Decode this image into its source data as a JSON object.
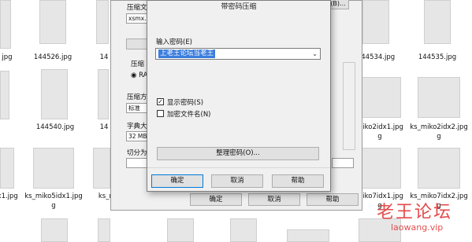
{
  "files": [
    {
      "label": "jpg"
    },
    {
      "label": "144526.jpg"
    },
    {
      "label": "14"
    },
    {
      "label": "144534.jpg"
    },
    {
      "label": "144535.jpg"
    },
    {
      "label": ""
    },
    {
      "label": "144540.jpg"
    },
    {
      "label": "14"
    },
    {
      "label": "miko2idx1.jpg"
    },
    {
      "label": "ks_miko2idx2.jpg"
    },
    {
      "label": "dx1.jpg"
    },
    {
      "label": "ks_miko5idx1.jpg"
    },
    {
      "label": "ks_mi"
    },
    {
      "label": "miko7idx1.jpg"
    },
    {
      "label": "ks_miko7idx2.jpg"
    }
  ],
  "archive_dialog": {
    "title_partial": "压缩文",
    "archive_name": "xsmx.r",
    "browse_label": "(B)...",
    "method_partial": "压缩",
    "radio_partial": "RA",
    "mode_partial": "压缩方",
    "mode_value": "标准",
    "dict_partial": "字典大",
    "dict_value": "32 MB",
    "split_partial": "切分为",
    "ok_label": "确定",
    "cancel_label": "取消",
    "help_label": "帮助"
  },
  "password_dialog": {
    "title": "带密码压缩",
    "password_label": "输入密码(E)",
    "password_value": "上老王论坛当老王",
    "show_password_label": "显示密码(S)",
    "show_password_checked": true,
    "encrypt_names_label": "加密文件名(N)",
    "encrypt_names_checked": false,
    "organize_label": "整理密码(O)...",
    "ok_label": "确定",
    "cancel_label": "取消",
    "help_label": "帮助"
  },
  "watermark": {
    "text": "老王论坛",
    "subtext": "laowang.vip"
  },
  "colors": {
    "accent": "#0078d7",
    "selection": "#3b7ddd",
    "watermark": "#e23c3c"
  }
}
